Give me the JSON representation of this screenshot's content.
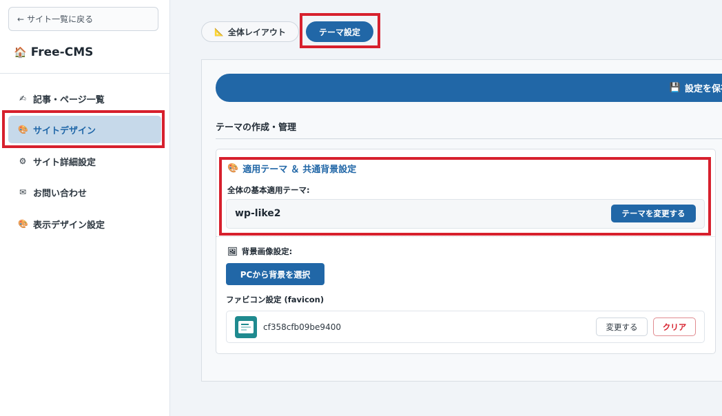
{
  "sidebar": {
    "back_label": "サイト一覧に戻る",
    "back_icon": "←",
    "brand": "Free-CMS",
    "brand_icon": "🏠",
    "items": [
      {
        "icon": "✍",
        "label": "記事・ページ一覧"
      },
      {
        "icon": "🎨",
        "label": "サイトデザイン"
      },
      {
        "icon": "⚙",
        "label": "サイト詳細設定"
      },
      {
        "icon": "✉",
        "label": "お問い合わせ"
      },
      {
        "icon": "🎨",
        "label": "表示デザイン設定"
      }
    ],
    "active_index": 1
  },
  "tabs": {
    "layout_icon": "📐",
    "layout_label": "全体レイアウト",
    "theme_label": "テーマ設定"
  },
  "toolbar": {
    "save_icon": "💾",
    "save_label": "設定を保存"
  },
  "main": {
    "section_title": "テーマの作成・管理",
    "card": {
      "icon": "🎨",
      "title": "適用テーマ ＆ 共通背景設定",
      "theme_label": "全体の基本適用テーマ:",
      "theme_value": "wp-like2",
      "change_theme_label": "テーマを変更する",
      "bg_icon": "🖼",
      "bg_label": "背景画像設定:",
      "bg_button_label": "PCから背景を選択",
      "favicon_label": "ファビコン設定 (favicon)",
      "favicon_name": "cf358cfb09be9400",
      "favicon_change_label": "変更する",
      "favicon_clear_label": "クリア"
    }
  },
  "colors": {
    "accent": "#2167a7",
    "highlight": "#d7202d",
    "active_nav_bg": "#c6d9ea"
  }
}
